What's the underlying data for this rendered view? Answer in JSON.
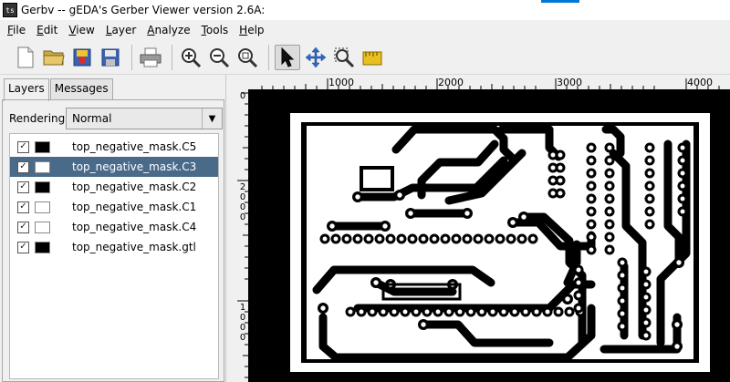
{
  "window": {
    "title": "Gerbv -- gEDA's Gerber Viewer version 2.6A:"
  },
  "menu": [
    {
      "label": "File",
      "u": "F",
      "rest": "ile"
    },
    {
      "label": "Edit",
      "u": "E",
      "rest": "dit"
    },
    {
      "label": "View",
      "u": "V",
      "rest": "iew"
    },
    {
      "label": "Layer",
      "u": "L",
      "rest": "ayer"
    },
    {
      "label": "Analyze",
      "u": "A",
      "rest": "nalyze"
    },
    {
      "label": "Tools",
      "u": "T",
      "rest": "ools"
    },
    {
      "label": "Help",
      "u": "H",
      "rest": "elp"
    }
  ],
  "toolbar": {
    "icons": [
      "new-file-icon",
      "open-folder-icon",
      "revert-icon",
      "save-icon",
      "print-icon",
      "zoom-in-icon",
      "zoom-out-icon",
      "zoom-fit-icon",
      "pointer-tool-icon",
      "pan-tool-icon",
      "zoom-tool-icon",
      "measure-tool-icon"
    ]
  },
  "tabs": {
    "layers": "Layers",
    "messages": "Messages"
  },
  "rendering": {
    "label": "Rendering:",
    "value": "Normal"
  },
  "layers": [
    {
      "name": "top_negative_mask.C5",
      "color": "#000000",
      "checked": true,
      "selected": false
    },
    {
      "name": "top_negative_mask.C3",
      "color": "#ffffff",
      "checked": true,
      "selected": true
    },
    {
      "name": "top_negative_mask.C2",
      "color": "#000000",
      "checked": true,
      "selected": false
    },
    {
      "name": "top_negative_mask.C1",
      "color": "#ffffff",
      "checked": true,
      "selected": false
    },
    {
      "name": "top_negative_mask.C4",
      "color": "#ffffff",
      "checked": true,
      "selected": false
    },
    {
      "name": "top_negative_mask.gtl",
      "color": "#000000",
      "checked": true,
      "selected": false
    }
  ],
  "ruler": {
    "top": [
      "1000",
      "2000",
      "3000",
      "4000"
    ],
    "left_top_digit": "0",
    "left_2000": [
      "2",
      "0",
      "0",
      "0"
    ],
    "left_1000": [
      "1",
      "0",
      "0",
      "0"
    ]
  }
}
